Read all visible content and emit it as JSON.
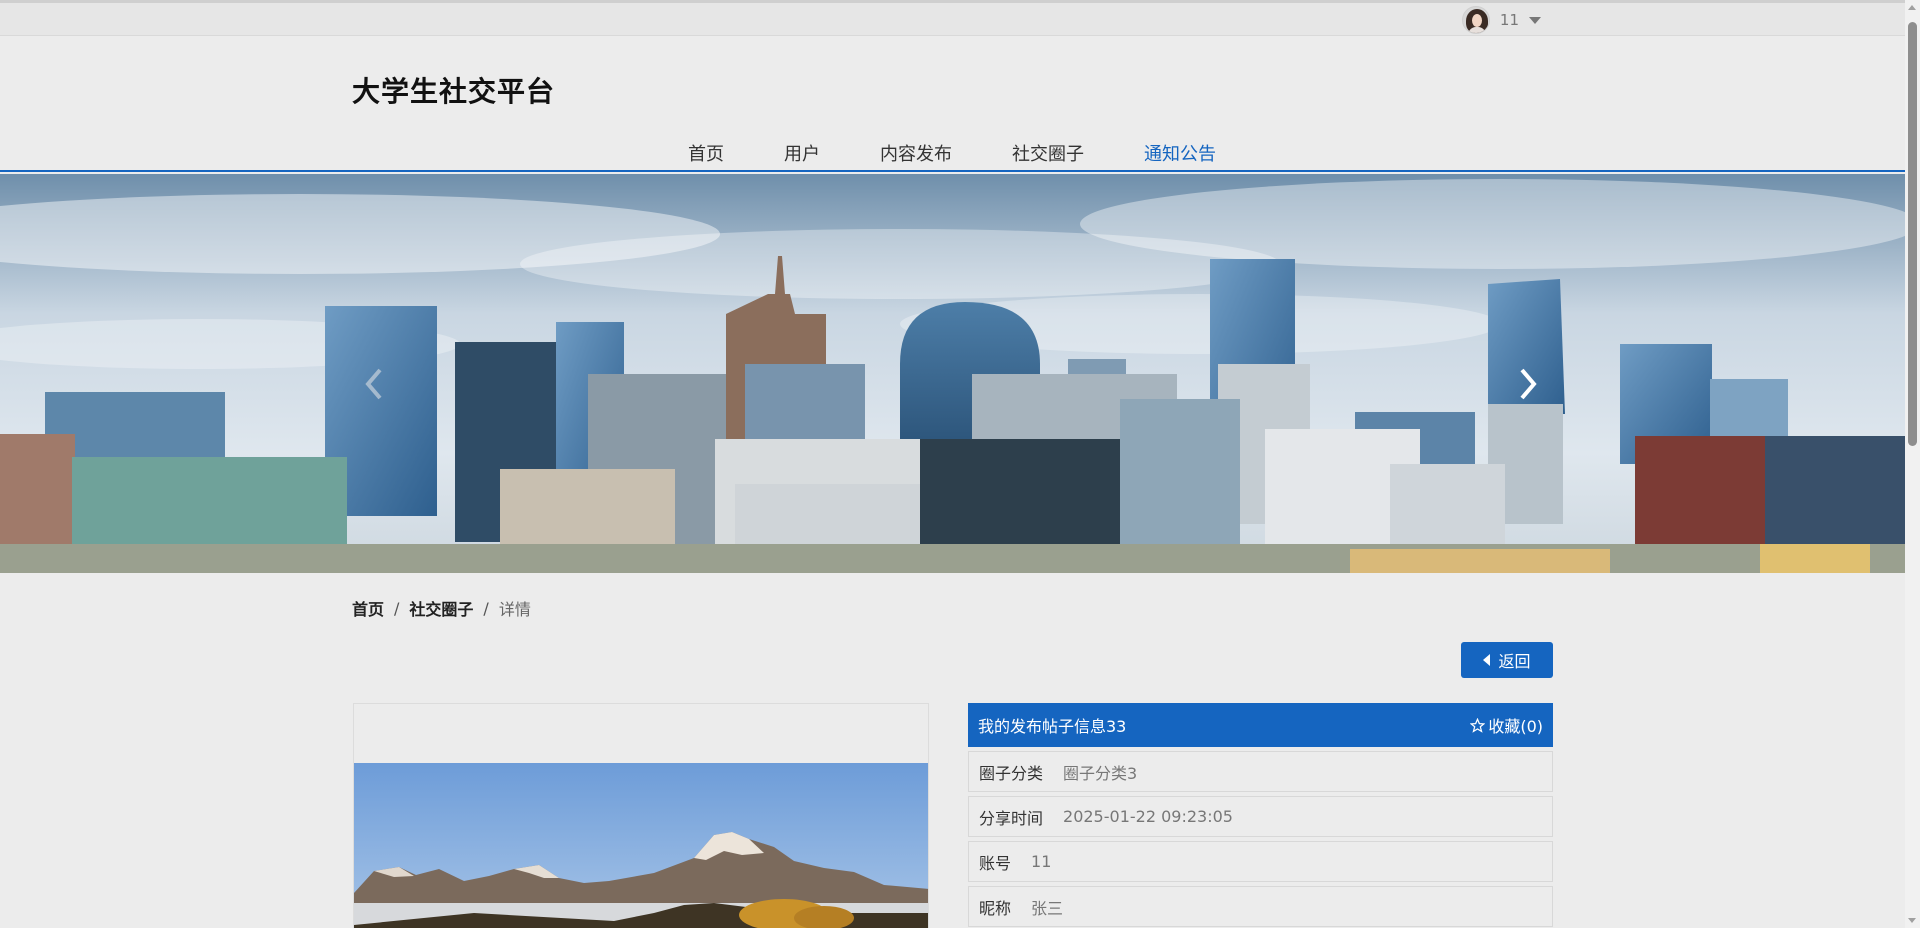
{
  "user": {
    "name": "11",
    "avatar_icon": "avatar-icon",
    "dropdown_icon": "caret-down-icon"
  },
  "site": {
    "title": "大学生社交平台"
  },
  "nav": {
    "items": [
      {
        "label": "首页",
        "active": false
      },
      {
        "label": "用户",
        "active": false
      },
      {
        "label": "内容发布",
        "active": false
      },
      {
        "label": "社交圈子",
        "active": false
      },
      {
        "label": "通知公告",
        "active": true
      }
    ]
  },
  "banner": {
    "prev_icon": "chevron-left-icon",
    "next_icon": "chevron-right-icon"
  },
  "breadcrumb": {
    "home": "首页",
    "section": "社交圈子",
    "current": "详情",
    "separator": "/"
  },
  "back_button": {
    "label": "返回",
    "icon": "caret-left-icon"
  },
  "detail": {
    "title": "我的发布帖子信息33",
    "favorite_label": "收藏(0)",
    "favorite_icon": "star-outline-icon",
    "fields": [
      {
        "label": "圈子分类",
        "value": "圈子分类3"
      },
      {
        "label": "分享时间",
        "value": "2025-01-22 09:23:05"
      },
      {
        "label": "账号",
        "value": "11"
      },
      {
        "label": "昵称",
        "value": "张三"
      }
    ]
  },
  "colors": {
    "accent": "#1565c0",
    "background": "#ececec",
    "topbar": "#e6e6e6"
  }
}
